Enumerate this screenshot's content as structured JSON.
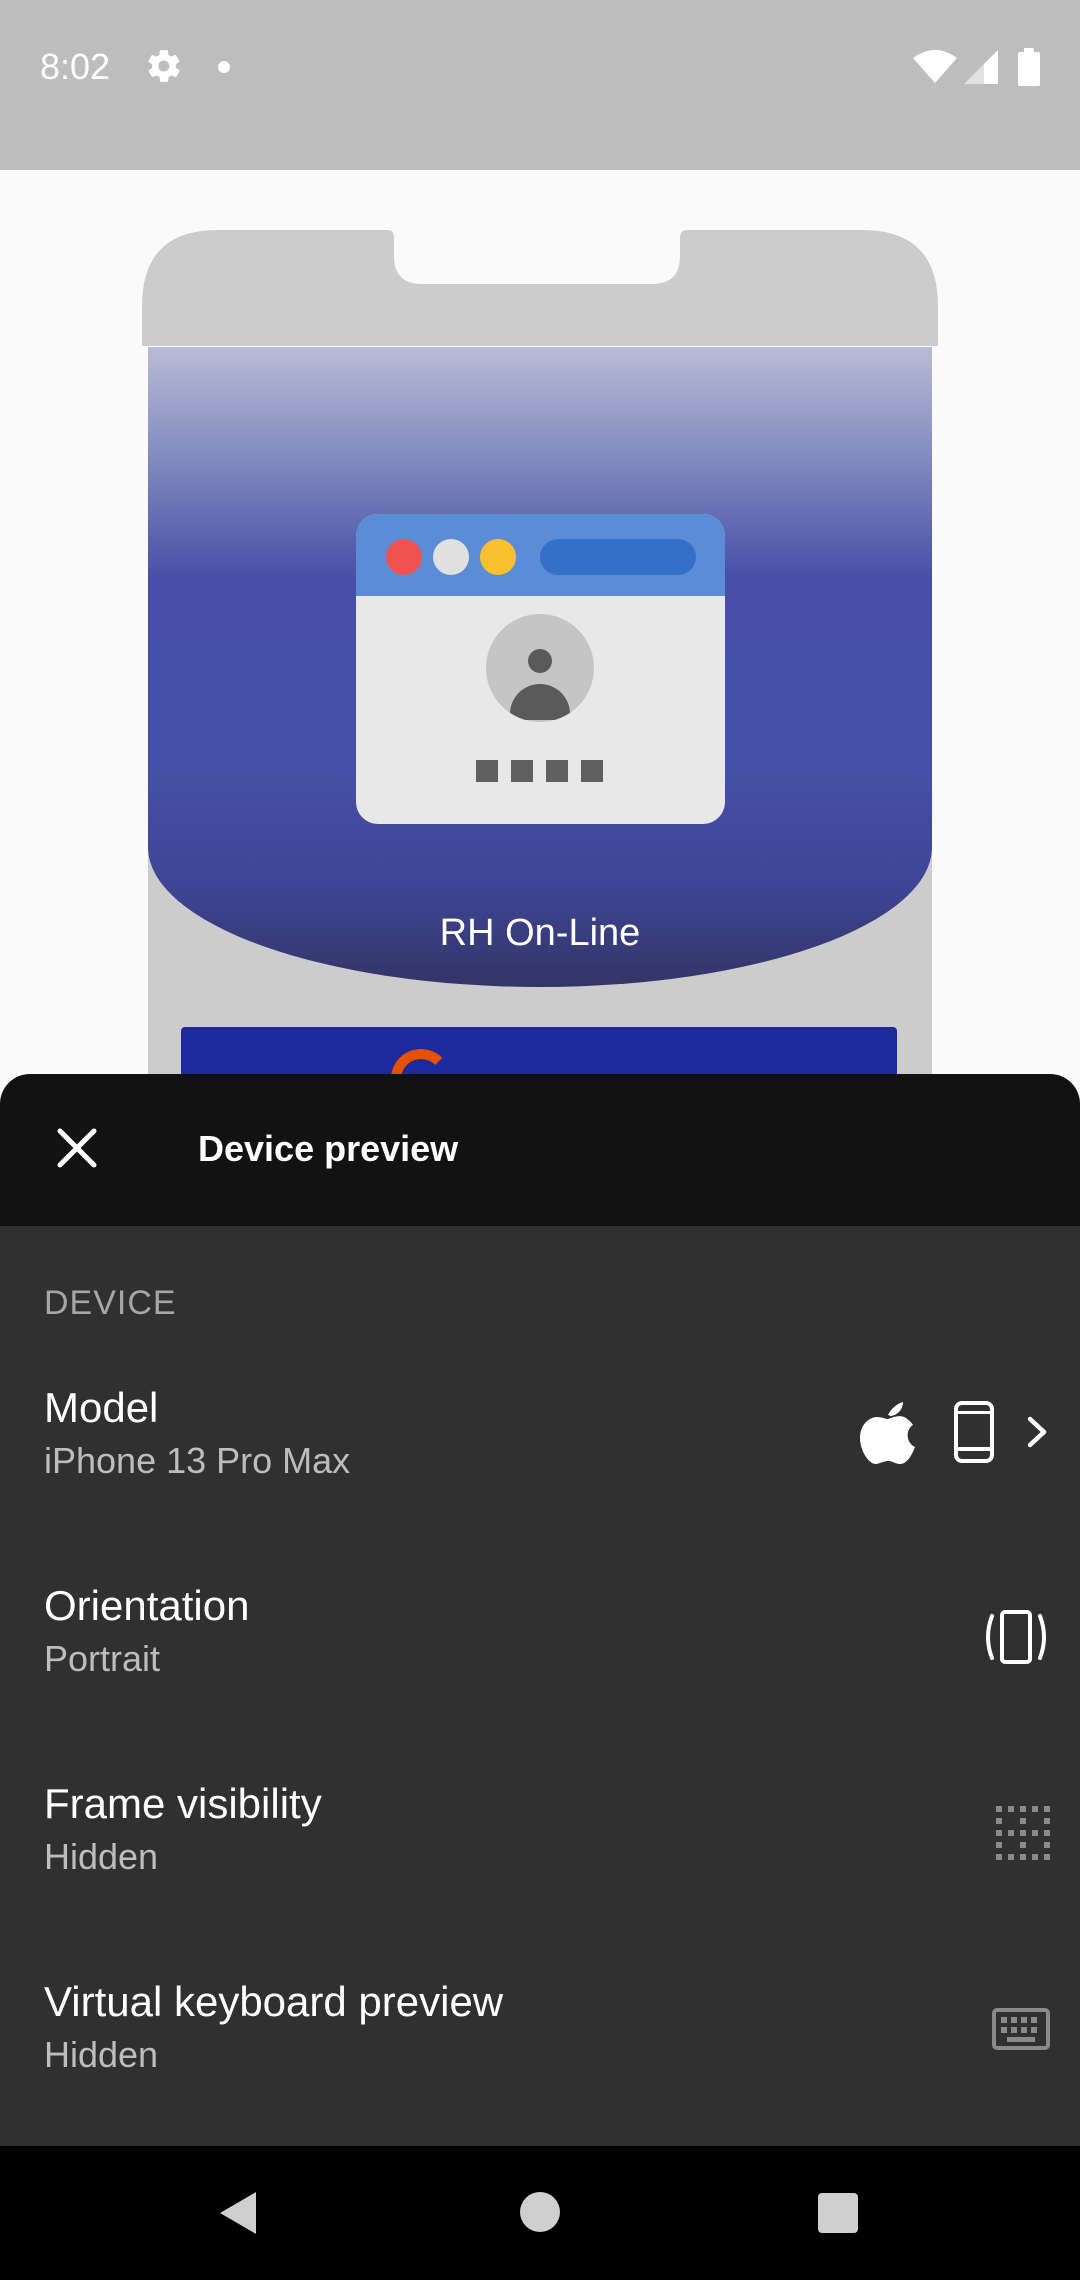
{
  "status_bar": {
    "time": "8:02",
    "icons": [
      "settings-icon",
      "notification-dot-icon",
      "wifi-icon",
      "cell-signal-icon",
      "battery-icon"
    ]
  },
  "preview": {
    "app_name": "RH On-Line",
    "colors": {
      "hero_blue": "#4650a6",
      "browser_bar": "#5b8dd6",
      "dot_red": "#ef5350",
      "dot_yellow": "#fbc02d",
      "button_blue": "#1e2a9c"
    }
  },
  "sheet": {
    "title": "Device preview",
    "section_title": "DEVICE",
    "rows": [
      {
        "label": "Model",
        "value": "iPhone 13 Pro Max",
        "icons": [
          "apple-icon",
          "phone-icon",
          "chevron-right-icon"
        ]
      },
      {
        "label": "Orientation",
        "value": "Portrait",
        "icons": [
          "screen-rotation-icon"
        ]
      },
      {
        "label": "Frame visibility",
        "value": "Hidden",
        "icons": [
          "frame-hidden-icon"
        ]
      },
      {
        "label": "Virtual keyboard preview",
        "value": "Hidden",
        "icons": [
          "keyboard-icon"
        ]
      }
    ]
  },
  "nav_bar": {
    "buttons": [
      "back-icon",
      "home-icon",
      "recents-icon"
    ]
  }
}
